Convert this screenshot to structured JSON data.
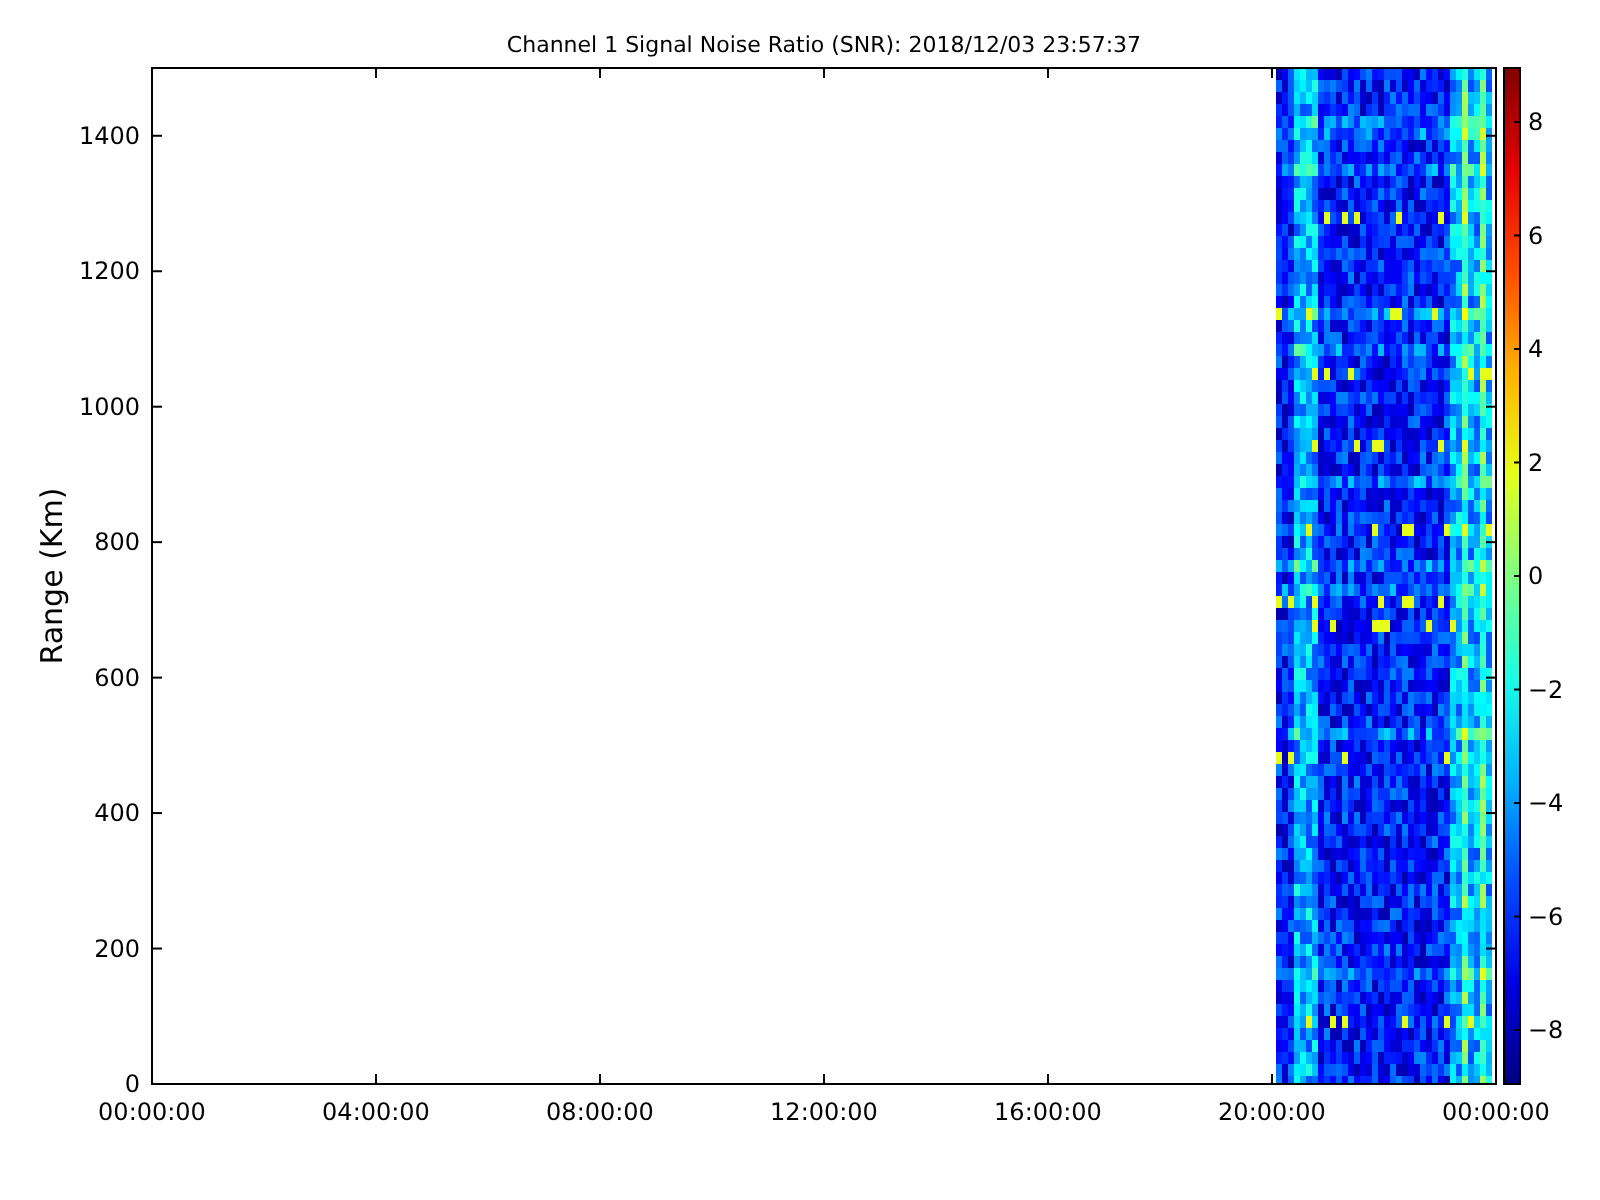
{
  "title": "Channel 1 Signal Noise Ratio (SNR): 2018/12/03 23:57:37",
  "ylabel": "Range (Km)",
  "xtick_labels": [
    "00:00:00",
    "04:00:00",
    "08:00:00",
    "12:00:00",
    "16:00:00",
    "20:00:00",
    "00:00:00"
  ],
  "ytick_labels": [
    "1400",
    "1200",
    "1000",
    "800",
    "600",
    "400",
    "200",
    "0"
  ],
  "colorbar_tick_labels": [
    "8",
    "6",
    "4",
    "2",
    "0",
    "−2",
    "−4",
    "−6",
    "−8"
  ],
  "heatmap": {
    "kind": "picture"
  }
}
